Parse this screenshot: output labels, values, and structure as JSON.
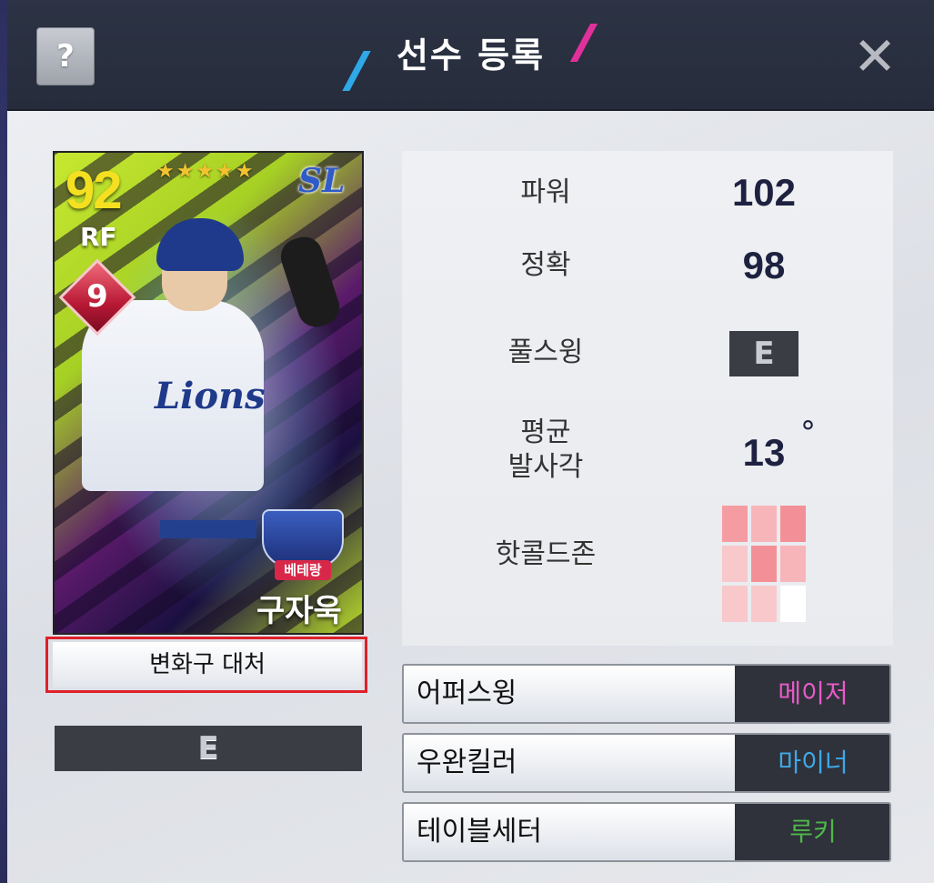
{
  "header": {
    "help_label": "?",
    "title": "선수 등록",
    "close_label": "✕"
  },
  "card": {
    "overall": "92",
    "position": "RF",
    "stars": "★★★★★",
    "team_logo": "SL",
    "jersey_text": "Lions",
    "grade": "9",
    "badge_label": "베테랑",
    "name": "구자욱"
  },
  "pitch_sub_label": "변화구 대처",
  "card_grade": "E",
  "stats": {
    "power_label": "파워",
    "power_value": "102",
    "accuracy_label": "정확",
    "accuracy_value": "98",
    "full_swing_label": "풀스윙",
    "full_swing_grade": "E",
    "launch_angle_label_1": "평균",
    "launch_angle_label_2": "발사각",
    "launch_angle_value": "13",
    "launch_angle_unit": "°",
    "hot_cold_label": "핫콜드존"
  },
  "hot_cold_zone": [
    [
      "#f59ca3",
      "#f7b5ba",
      "#f39097"
    ],
    [
      "#f8c8cb",
      "#f39097",
      "#f7b5ba"
    ],
    [
      "#f8c8cb",
      "#f8c8cb",
      "#ffffff"
    ]
  ],
  "traits": [
    {
      "name": "어퍼스윙",
      "level": "메이저",
      "color": "#e85ac8"
    },
    {
      "name": "우완킬러",
      "level": "마이너",
      "color": "#3fa8e8"
    },
    {
      "name": "테이블세터",
      "level": "루키",
      "color": "#4fb84a"
    }
  ]
}
